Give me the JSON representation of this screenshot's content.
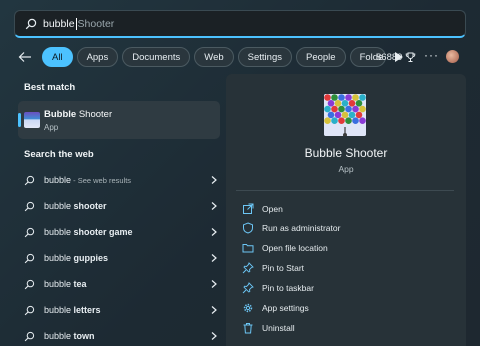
{
  "search": {
    "typed": "bubble",
    "suggestion": " Shooter"
  },
  "filters": [
    {
      "label": "All",
      "active": true
    },
    {
      "label": "Apps"
    },
    {
      "label": "Documents"
    },
    {
      "label": "Web"
    },
    {
      "label": "Settings"
    },
    {
      "label": "People"
    },
    {
      "label": "Folde"
    }
  ],
  "rewards": {
    "points": "86889"
  },
  "best_match": {
    "heading": "Best match",
    "name_bold": "Bubble",
    "name_rest": " Shooter",
    "type": "App"
  },
  "web": {
    "heading": "Search the web",
    "items": [
      {
        "q": "bubble",
        "s": "",
        "extra": " - See web results"
      },
      {
        "q": "bubble ",
        "s": "shooter",
        "extra": ""
      },
      {
        "q": "bubble ",
        "s": "shooter game",
        "extra": ""
      },
      {
        "q": "bubble ",
        "s": "guppies",
        "extra": ""
      },
      {
        "q": "bubble ",
        "s": "tea",
        "extra": ""
      },
      {
        "q": "bubble ",
        "s": "letters",
        "extra": ""
      },
      {
        "q": "bubble ",
        "s": "town",
        "extra": ""
      }
    ]
  },
  "detail": {
    "title": "Bubble Shooter",
    "type": "App",
    "actions": [
      {
        "label": "Open",
        "icon": "open-icon"
      },
      {
        "label": "Run as administrator",
        "icon": "shield-icon"
      },
      {
        "label": "Open file location",
        "icon": "folder-icon"
      },
      {
        "label": "Pin to Start",
        "icon": "pin-icon"
      },
      {
        "label": "Pin to taskbar",
        "icon": "pin-icon"
      },
      {
        "label": "App settings",
        "icon": "gear-icon"
      },
      {
        "label": "Uninstall",
        "icon": "trash-icon"
      }
    ]
  },
  "colors": {
    "accent": "#4cc2ff",
    "panel": "#273238",
    "selected": "#2f3b42"
  }
}
